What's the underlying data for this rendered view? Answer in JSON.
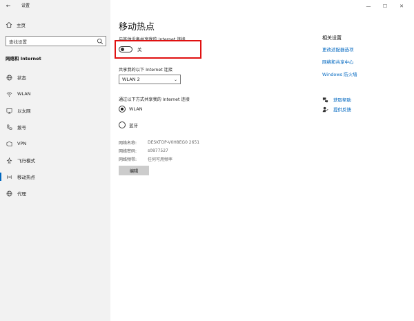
{
  "window": {
    "title": "设置"
  },
  "sidebar": {
    "home_label": "主页",
    "search_placeholder": "查找设置",
    "section": "网络和 Internet",
    "items": [
      {
        "label": "状态",
        "icon": "globe-icon"
      },
      {
        "label": "WLAN",
        "icon": "wifi-icon"
      },
      {
        "label": "以太网",
        "icon": "ethernet-icon"
      },
      {
        "label": "拨号",
        "icon": "phone-icon"
      },
      {
        "label": "VPN",
        "icon": "vpn-icon"
      },
      {
        "label": "飞行模式",
        "icon": "airplane-icon"
      },
      {
        "label": "移动热点",
        "icon": "hotspot-icon",
        "active": true
      },
      {
        "label": "代理",
        "icon": "globe-icon"
      }
    ]
  },
  "main": {
    "title": "移动热点",
    "share_label": "与其他设备共享我的 Internet 连接",
    "toggle_state": "关",
    "share_from_label": "共享我的以下 Internet 连接",
    "share_from_value": "WLAN 2",
    "share_via_label": "通过以下方式共享我的 Internet 连接",
    "options": [
      "WLAN",
      "蓝牙"
    ],
    "selected_option": "WLAN",
    "info": [
      {
        "key": "网络名称:",
        "value": "DESKTOP-V0H8EG0 2651"
      },
      {
        "key": "网络密码:",
        "value": "s0877527"
      },
      {
        "key": "网络频带:",
        "value": "任何可用频率"
      }
    ],
    "edit_label": "编辑"
  },
  "related": {
    "heading": "相关设置",
    "links": [
      "更改适配器选项",
      "网络和共享中心",
      "Windows 防火墙"
    ]
  },
  "help": {
    "get_help": "获取帮助",
    "feedback": "提供反馈"
  },
  "colors": {
    "accent": "#0067c0",
    "highlight": "#e01010",
    "sidebar_bg": "#f2f2f2"
  }
}
